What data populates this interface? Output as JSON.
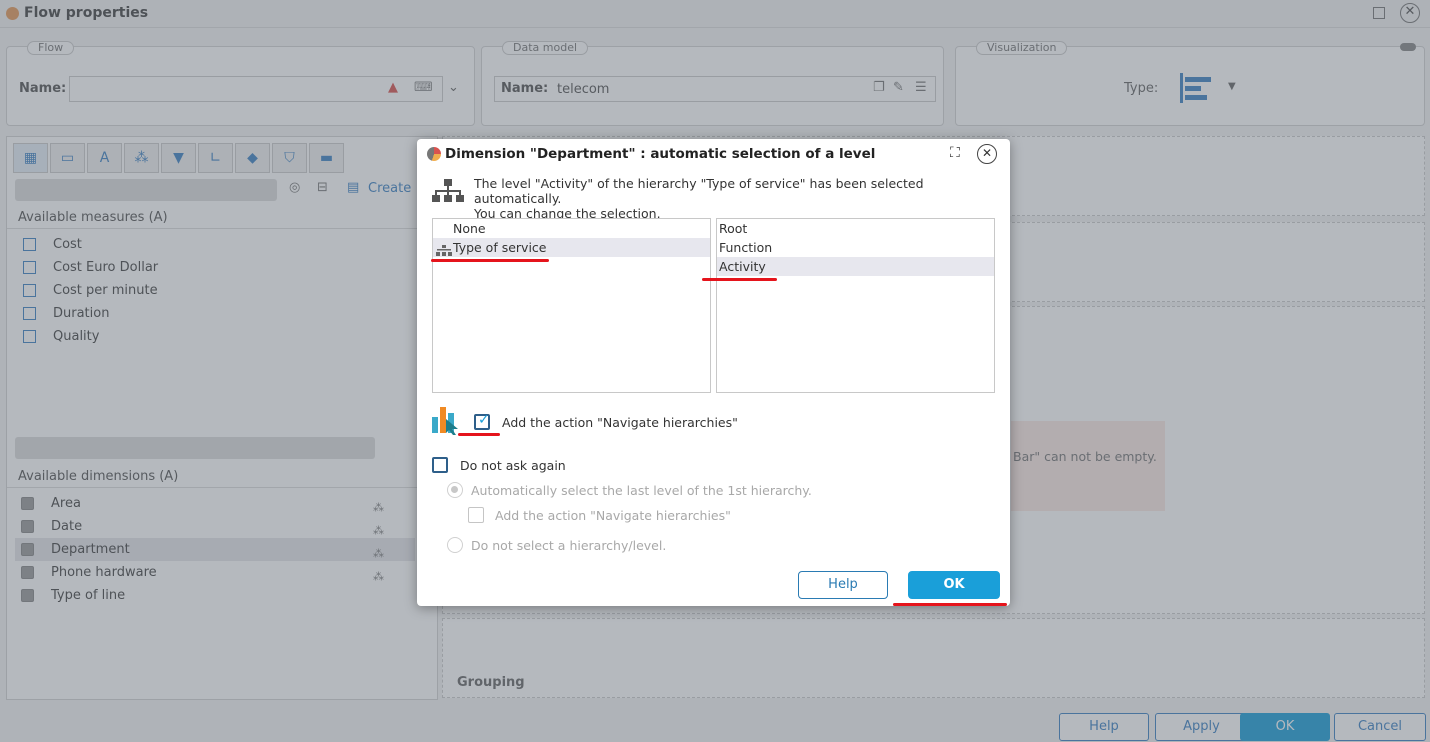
{
  "window": {
    "title": "Flow properties"
  },
  "flow_group": {
    "legend": "Flow",
    "name_label": "Name:",
    "name_value": ""
  },
  "data_model_group": {
    "legend": "Data model",
    "name_label": "Name:",
    "name_value": "telecom"
  },
  "visualization_group": {
    "legend": "Visualization",
    "type_label": "Type:"
  },
  "left_panel": {
    "create_label": "Create",
    "measures_header": "Available measures (A)",
    "measures": [
      "Cost",
      "Cost Euro Dollar",
      "Cost per minute",
      "Duration",
      "Quality"
    ],
    "dimensions_header": "Available dimensions (A)",
    "dimensions": [
      {
        "label": "Area",
        "hier": true
      },
      {
        "label": "Date",
        "hier": true
      },
      {
        "label": "Department",
        "hier": true,
        "selected": true
      },
      {
        "label": "Phone hardware",
        "hier": true
      },
      {
        "label": "Type of line",
        "hier": false
      }
    ]
  },
  "right_panel": {
    "error_fragment": "Bar\" can not be empty.",
    "grouping_label": "Grouping"
  },
  "bottom_buttons": {
    "help": "Help",
    "apply": "Apply",
    "ok": "OK",
    "cancel": "Cancel"
  },
  "dialog": {
    "title": "Dimension \"Department\" : automatic selection of a level",
    "message_line1": "The level \"Activity\" of the hierarchy \"Type of service\" has been selected automatically.",
    "message_line2": "You can change the selection.",
    "hierarchies": [
      "None",
      "Type of service"
    ],
    "levels": [
      "Root",
      "Function",
      "Activity"
    ],
    "add_action_label": "Add the action \"Navigate hierarchies\"",
    "add_action_checked": true,
    "do_not_ask_label": "Do not ask again",
    "do_not_ask_checked": false,
    "auto_select_label": "Automatically select the last level of the 1st hierarchy.",
    "sub_add_action_label": "Add the action \"Navigate hierarchies\"",
    "no_select_label": "Do not select a hierarchy/level.",
    "help_button": "Help",
    "ok_button": "OK"
  },
  "colors": {
    "accent": "#1a9fd9",
    "highlight": "#e5141c",
    "selection": "#e7e7ee"
  }
}
